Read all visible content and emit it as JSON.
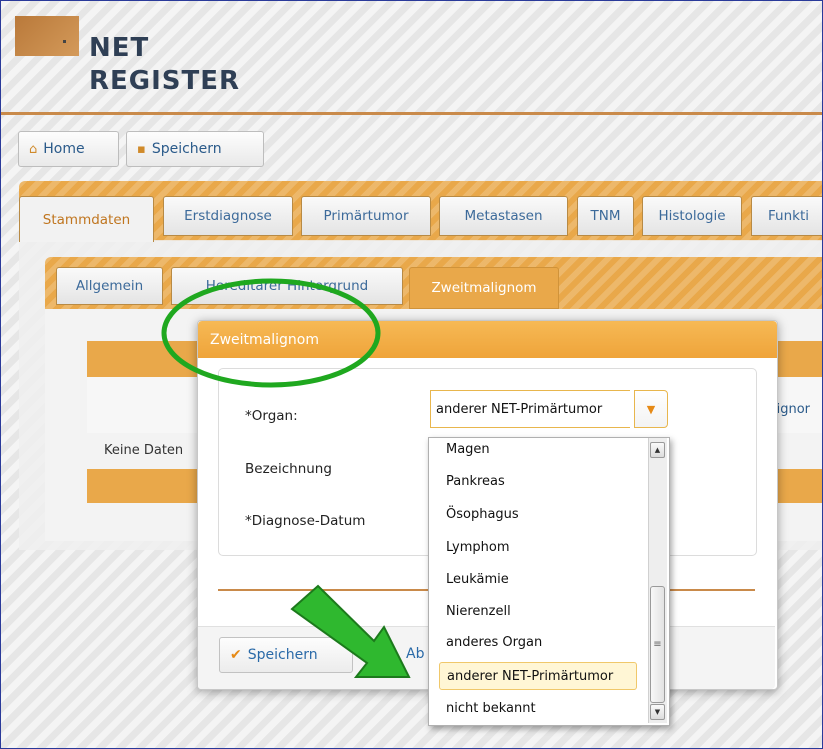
{
  "logo": {
    "line1": "NET",
    "line2": "REGISTER"
  },
  "toolbar": {
    "home_label": "Home",
    "save_label": "Speichern"
  },
  "main_tabs": [
    {
      "label": "Stammdaten"
    },
    {
      "label": "Erstdiagnose"
    },
    {
      "label": "Primärtumor"
    },
    {
      "label": "Metastasen"
    },
    {
      "label": "TNM"
    },
    {
      "label": "Histologie"
    },
    {
      "label": "Funkti"
    }
  ],
  "sub_tabs": [
    {
      "label": "Allgemein"
    },
    {
      "label": "Hereditärer Hintergrund"
    },
    {
      "label": "Zweitmalignom"
    }
  ],
  "background": {
    "no_data": "Keine Daten",
    "cut_text": "lignor"
  },
  "modal": {
    "title": "Zweitmalignom",
    "organ_label": "*Organ:",
    "organ_value": "anderer NET-Primärtumor",
    "bezeichnung_label": "Bezeichnung",
    "diagnose_label": "*Diagnose-Datum",
    "save_label": "Speichern",
    "cancel_partial": "Ab"
  },
  "dropdown": {
    "options": [
      "Magen",
      "Pankreas",
      "Ösophagus",
      "Lymphom",
      "Leukämie",
      "Nierenzell",
      "anderes Organ",
      "anderer NET-Primärtumor",
      "nicht bekannt"
    ],
    "selected": "anderer NET-Primärtumor"
  },
  "colors": {
    "accent_orange": "#e9a84a",
    "link_blue": "#3c6a9a",
    "annotation_green": "#1fa81f"
  }
}
